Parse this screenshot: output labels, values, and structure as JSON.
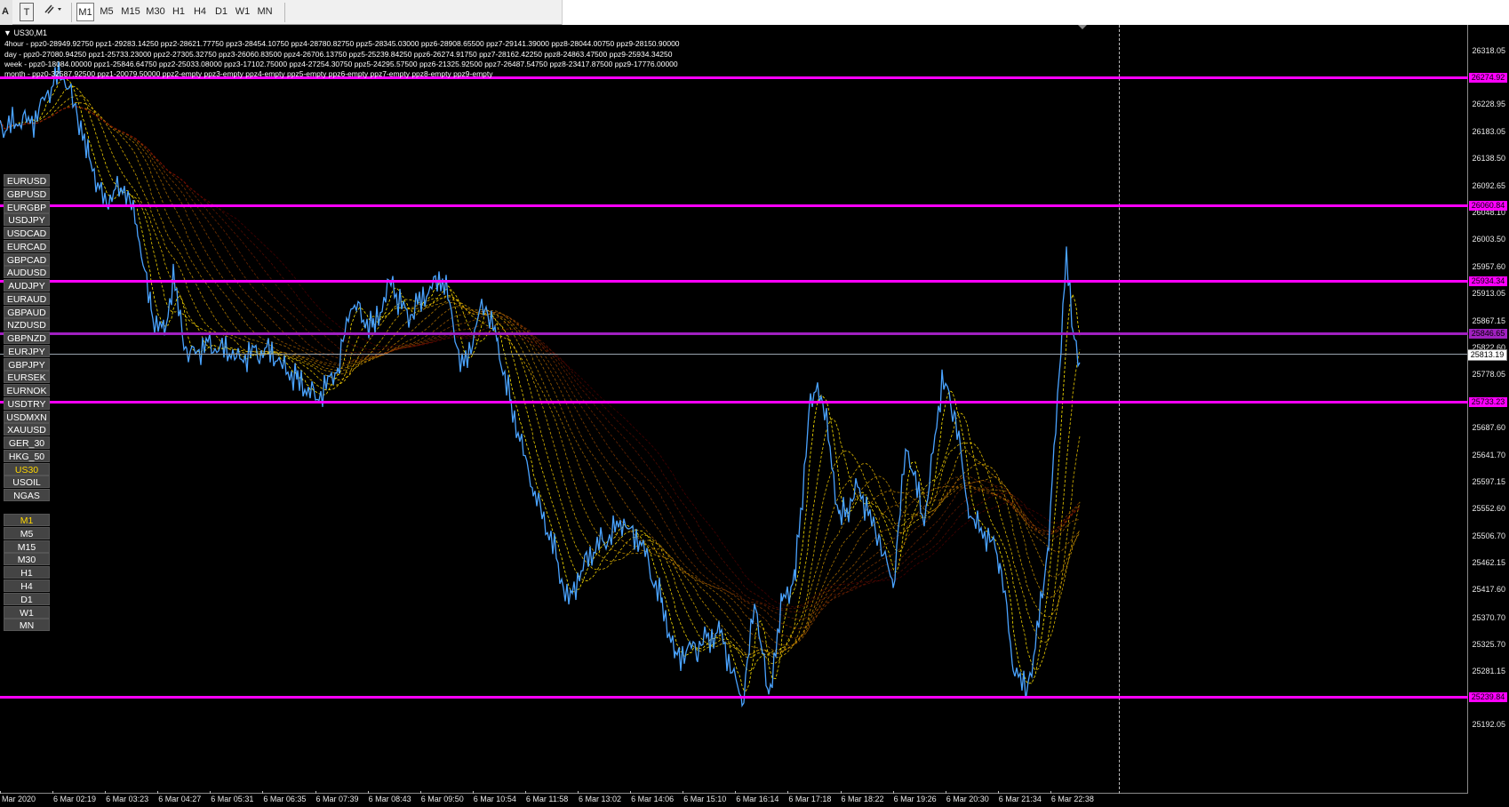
{
  "toolbar": {
    "a_label": "A",
    "t_label": "T",
    "timeframes": [
      "M1",
      "M5",
      "M15",
      "M30",
      "H1",
      "H4",
      "D1",
      "W1",
      "MN"
    ],
    "selected_timeframe": "M1"
  },
  "chart": {
    "title": "US30,M1",
    "pivots": {
      "hour4": "4hour - ppz0-28949.92750 ppz1-29283.14250 ppz2-28621.77750 ppz3-28454.10750 ppz4-28780.82750 ppz5-28345.03000 ppz6-28908.65500 ppz7-29141.39000 ppz8-28044.00750 ppz9-28150.90000",
      "day": "day - ppz0-27080.94250 ppz1-25733.23000 ppz2-27305.32750 ppz3-26060.83500 ppz4-26706.13750 ppz5-25239.84250 ppz6-26274.91750 ppz7-28162.42250 ppz8-24863.47500 ppz9-25934.34250",
      "week": "week - ppz0-18084.00000 ppz1-25846.64750 ppz2-25033.08000 ppz3-17102.75000 ppz4-27254.30750 ppz5-24295.57500 ppz6-21325.92500 ppz7-26487.54750 ppz8-23417.87500 ppz9-17776.00000",
      "month": "month - ppz0-32587.92500 ppz1-20079.50000 ppz2-empty ppz3-empty ppz4-empty ppz5-empty ppz6-empty ppz7-empty ppz8-empty ppz9-empty"
    },
    "symbols": [
      "EURUSD",
      "GBPUSD",
      "EURGBP",
      "USDJPY",
      "USDCAD",
      "EURCAD",
      "GBPCAD",
      "AUDUSD",
      "AUDJPY",
      "EURAUD",
      "GBPAUD",
      "NZDUSD",
      "GBPNZD",
      "EURJPY",
      "GBPJPY",
      "EURSEK",
      "EURNOK",
      "USDTRY",
      "USDMXN",
      "XAUUSD",
      "GER_30",
      "HKG_50",
      "US30",
      "USOIL",
      "NGAS"
    ],
    "active_symbol": "US30",
    "timeframe_buttons": [
      "M1",
      "M5",
      "M15",
      "M30",
      "H1",
      "H4",
      "D1",
      "W1",
      "MN"
    ],
    "active_timeframe": "M1",
    "price_axis": [
      "26318.05",
      "26228.95",
      "26183.05",
      "26138.50",
      "26092.65",
      "26048.10",
      "26003.50",
      "25957.60",
      "25913.05",
      "25867.15",
      "25822.60",
      "25778.05",
      "25687.60",
      "25641.70",
      "25597.15",
      "25552.60",
      "25506.70",
      "25462.15",
      "25417.60",
      "25370.70",
      "25325.70",
      "25281.15",
      "25192.05"
    ],
    "price_levels": [
      {
        "price": "26274.92",
        "color": "#ff00ff"
      },
      {
        "price": "26060.84",
        "color": "#ff00ff"
      },
      {
        "price": "25934.34",
        "color": "#ff00ff"
      },
      {
        "price": "25846.65",
        "color": "#a020c0"
      },
      {
        "price": "25733.23",
        "color": "#ff00ff"
      },
      {
        "price": "25239.84",
        "color": "#ff00ff"
      }
    ],
    "current_price": "25813.19",
    "time_axis": [
      "Mar 2020",
      "6 Mar 02:19",
      "6 Mar 03:23",
      "6 Mar 04:27",
      "6 Mar 05:31",
      "6 Mar 06:35",
      "6 Mar 07:39",
      "6 Mar 08:43",
      "6 Mar 09:50",
      "6 Mar 10:54",
      "6 Mar 11:58",
      "6 Mar 13:02",
      "6 Mar 14:06",
      "6 Mar 15:10",
      "6 Mar 16:14",
      "6 Mar 17:18",
      "6 Mar 18:22",
      "6 Mar 19:26",
      "6 Mar 20:30",
      "6 Mar 21:34",
      "6 Mar 22:38"
    ],
    "colors": {
      "background": "#000000",
      "price_line": "#4aa3ff",
      "level_line": "#ff00ff",
      "ribbon_inner": "#ffff00",
      "ribbon_outer": "#8b0000"
    }
  }
}
